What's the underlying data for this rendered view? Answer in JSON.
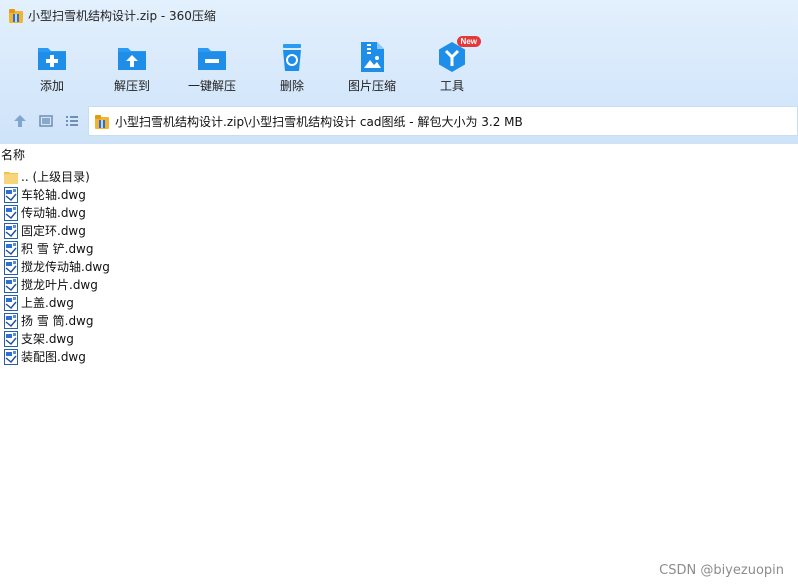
{
  "window": {
    "title": "小型扫雪机结构设计.zip - 360压缩"
  },
  "toolbar": {
    "items": [
      {
        "label": "添加",
        "icon": "add-icon"
      },
      {
        "label": "解压到",
        "icon": "extract-to-icon"
      },
      {
        "label": "一键解压",
        "icon": "one-click-extract-icon"
      },
      {
        "label": "删除",
        "icon": "delete-icon"
      },
      {
        "label": "图片压缩",
        "icon": "image-compress-icon"
      },
      {
        "label": "工具",
        "icon": "tools-icon",
        "badge": "New"
      }
    ]
  },
  "nav": {
    "path": "小型扫雪机结构设计.zip\\小型扫雪机结构设计 cad图纸 - 解包大小为 3.2 MB"
  },
  "list": {
    "column_name": "名称",
    "items": [
      {
        "name": ".. (上级目录)",
        "type": "folder"
      },
      {
        "name": "车轮轴.dwg",
        "type": "dwg"
      },
      {
        "name": "传动轴.dwg",
        "type": "dwg"
      },
      {
        "name": "固定环.dwg",
        "type": "dwg"
      },
      {
        "name": "积  雪  铲.dwg",
        "type": "dwg"
      },
      {
        "name": "搅龙传动轴.dwg",
        "type": "dwg"
      },
      {
        "name": "搅龙叶片.dwg",
        "type": "dwg"
      },
      {
        "name": "上盖.dwg",
        "type": "dwg"
      },
      {
        "name": "扬  雪  筒.dwg",
        "type": "dwg"
      },
      {
        "name": "支架.dwg",
        "type": "dwg"
      },
      {
        "name": "装配图.dwg",
        "type": "dwg"
      }
    ]
  },
  "watermark": "CSDN @biyezuopin",
  "colors": {
    "accent": "#1e8ee8",
    "badge": "#e23a3a",
    "toolbar_bg": "#d6e8fb"
  }
}
